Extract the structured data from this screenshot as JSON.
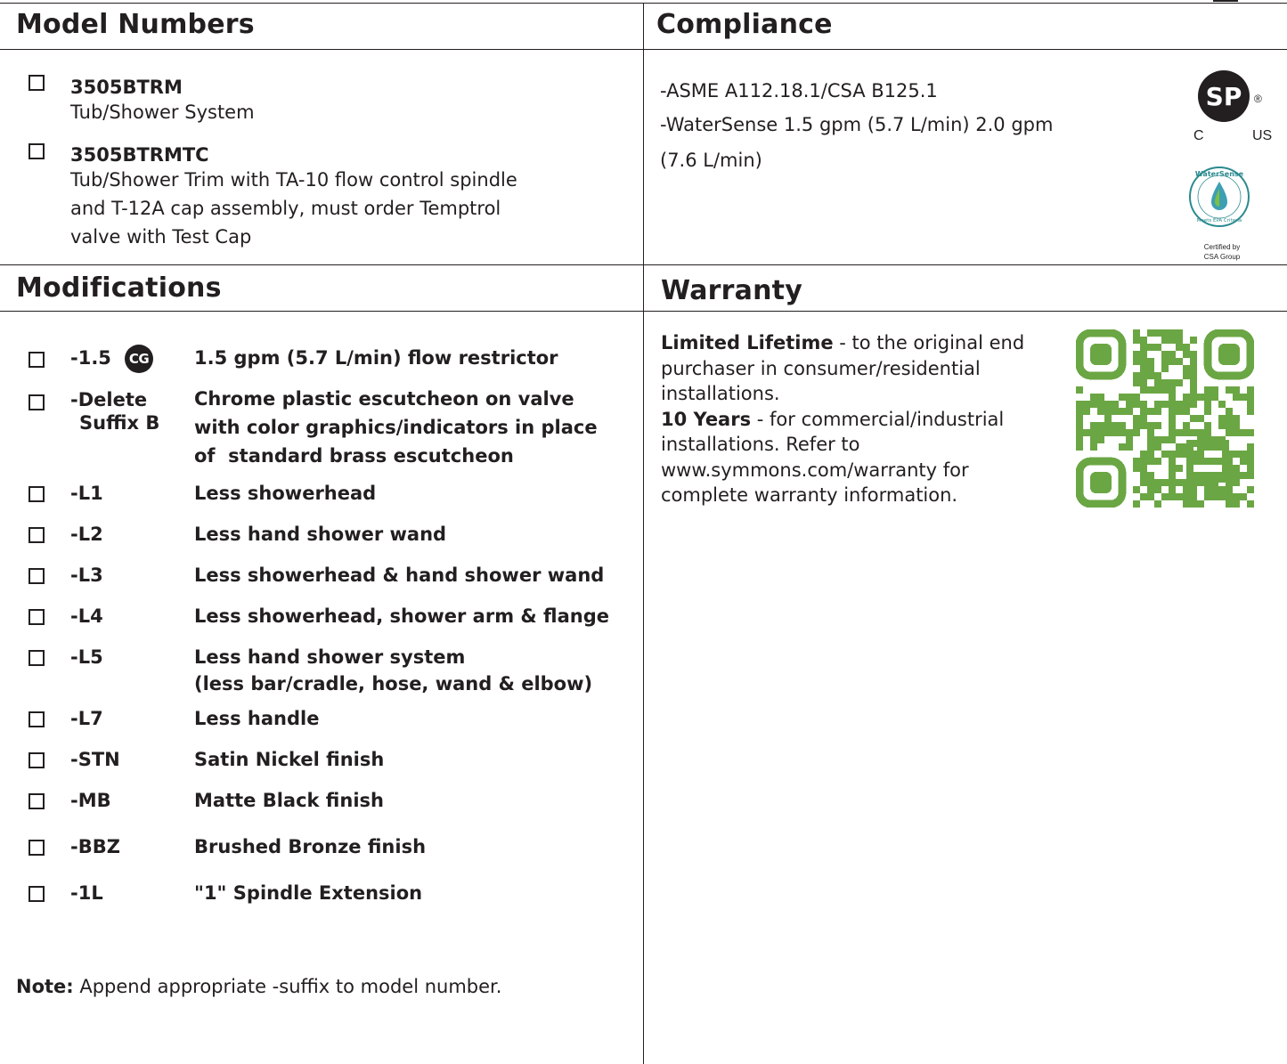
{
  "model_numbers": {
    "title": "Model Numbers",
    "items": [
      {
        "code": "3505BTRM",
        "desc": "Tub/Shower System"
      },
      {
        "code": "3505BTRMTC",
        "desc_lines": [
          "Tub/Shower Trim with TA-10 flow control spindle",
          "and T-12A cap assembly, must order Temptrol",
          "valve with Test Cap"
        ]
      }
    ]
  },
  "compliance": {
    "title": "Compliance",
    "lines": [
      "-ASME A112.18.1/CSA B125.1",
      "-WaterSense 1.5 gpm (5.7 L/min) 2.0 gpm",
      "(7.6 L/min)"
    ],
    "csa_logo": {
      "mark": "SP",
      "registered": "®",
      "left": "C",
      "right": "US"
    },
    "watersense_logo": {
      "top": "WaterSense",
      "bottom": "Meets EPA Criteria",
      "certified_line1": "Certified by",
      "certified_line2": "CSA Group"
    }
  },
  "modifications": {
    "title": "Modifications",
    "items": [
      {
        "code": "-1.5",
        "badge": "CG",
        "desc": "1.5 gpm (5.7 L/min) flow restrictor"
      },
      {
        "code_lines": [
          "-Delete",
          "Suffix B"
        ],
        "desc_lines": [
          "Chrome plastic escutcheon on valve",
          "with color graphics/indicators in place",
          "of  standard brass escutcheon"
        ]
      },
      {
        "code": "-L1",
        "desc": "Less showerhead"
      },
      {
        "code": "-L2",
        "desc": "Less hand shower wand"
      },
      {
        "code": "-L3",
        "desc": "Less showerhead & hand shower wand"
      },
      {
        "code": "-L4",
        "desc": "Less showerhead, shower arm & flange"
      },
      {
        "code": "-L5",
        "desc_lines": [
          "Less hand shower system",
          "(less bar/cradle, hose, wand & elbow)"
        ]
      },
      {
        "code": "-L7",
        "desc": "Less handle"
      },
      {
        "code": "-STN",
        "desc": "Satin Nickel finish"
      },
      {
        "code": "-MB",
        "desc": "Matte Black finish"
      },
      {
        "code": "-BBZ",
        "desc": "Brushed Bronze finish"
      },
      {
        "code": "-1L",
        "desc": "\"1\" Spindle Extension"
      }
    ],
    "note_label": "Note:",
    "note_text": " Append appropriate -suffix to model number."
  },
  "warranty": {
    "title": "Warranty",
    "lifetime_label": "Limited Lifetime",
    "lifetime_lines": [
      " - to the original end",
      "purchaser in consumer/residential",
      "installations."
    ],
    "years_label": "10 Years",
    "years_lines": [
      " - for commercial/industrial",
      "installations. Refer to",
      "www.symmons.com/warranty for",
      "complete warranty information."
    ],
    "qr_color": "#6ba644"
  }
}
